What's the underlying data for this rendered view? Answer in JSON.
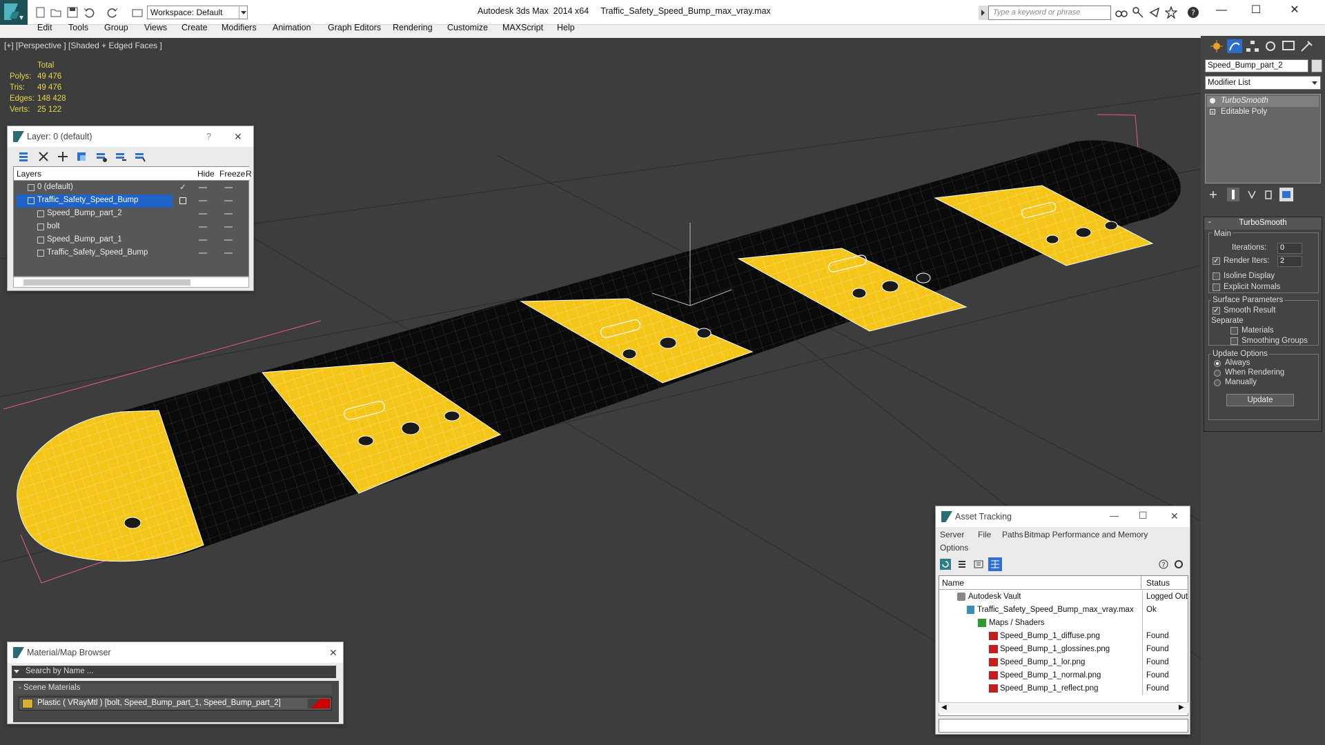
{
  "app": {
    "title": "Autodesk 3ds Max  2014 x64     Traffic_Safety_Speed_Bump_max_vray.max",
    "workspace": "Workspace: Default",
    "search_placeholder": "Type a keyword or phrase"
  },
  "menu": [
    "Edit",
    "Tools",
    "Group",
    "Views",
    "Create",
    "Modifiers",
    "Animation",
    "Graph Editors",
    "Rendering",
    "Customize",
    "MAXScript",
    "Help"
  ],
  "viewport": {
    "label": "[+] [Perspective ] [Shaded + Edged Faces ]",
    "stats": {
      "header": "Total",
      "rows": [
        {
          "k": "Polys:",
          "v": "49 476"
        },
        {
          "k": "Tris:",
          "v": "49 476"
        },
        {
          "k": "Edges:",
          "v": "148 428"
        },
        {
          "k": "Verts:",
          "v": "25 122"
        }
      ]
    },
    "colors": {
      "yellow": "#f5c518",
      "black": "#0a0a0a",
      "wire": "#ffffff",
      "bg": "#3d3d3d"
    }
  },
  "layer_panel": {
    "title": "Layer: 0 (default)",
    "help": "?",
    "close": "✕",
    "col_layers": "Layers",
    "col_hide": "Hide",
    "col_freeze": "Freeze",
    "col_r": "R",
    "rows": [
      {
        "name": "0 (default)"
      },
      {
        "name": "Traffic_Safety_Speed_Bump"
      },
      {
        "name": "Speed_Bump_part_2"
      },
      {
        "name": "bolt"
      },
      {
        "name": "Speed_Bump_part_1"
      },
      {
        "name": "Traffic_Safety_Speed_Bump"
      }
    ]
  },
  "material_browser": {
    "title": "Material/Map Browser",
    "close": "✕",
    "search_placeholder": "Search by Name ...",
    "section": "- Scene Materials",
    "item": "Plastic  ( VRayMtl )  [bolt, Speed_Bump_part_1, Speed_Bump_part_2]"
  },
  "asset_tracking": {
    "title": "Asset Tracking",
    "menu": [
      "Server",
      "File",
      "Paths",
      "Bitmap Performance and Memory"
    ],
    "menu2": "Options",
    "col_name": "Name",
    "col_status": "Status",
    "rows": [
      {
        "name": "Autodesk Vault",
        "status": "Logged Out"
      },
      {
        "name": "Traffic_Safety_Speed_Bump_max_vray.max",
        "status": "Ok"
      },
      {
        "name": "Maps / Shaders",
        "status": ""
      },
      {
        "name": "Speed_Bump_1_diffuse.png",
        "status": "Found"
      },
      {
        "name": "Speed_Bump_1_glossines.png",
        "status": "Found"
      },
      {
        "name": "Speed_Bump_1_lor.png",
        "status": "Found"
      },
      {
        "name": "Speed_Bump_1_normal.png",
        "status": "Found"
      },
      {
        "name": "Speed_Bump_1_reflect.png",
        "status": "Found"
      }
    ]
  },
  "command_panel": {
    "object_name": "Speed_Bump_part_2",
    "modifier_list": "Modifier List",
    "stack": [
      "TurboSmooth",
      "Editable Poly"
    ],
    "rollout_title": "TurboSmooth",
    "main": "Main",
    "iterations_label": "Iterations:",
    "iterations": "0",
    "render_iters_label": "Render Iters:",
    "render_iters": "2",
    "isoline": "Isoline Display",
    "explicit_normals": "Explicit Normals",
    "surface_params": "Surface Parameters",
    "smooth_result": "Smooth Result",
    "separate": "Separate",
    "materials": "Materials",
    "smoothing_groups": "Smoothing Groups",
    "update_options": "Update Options",
    "always": "Always",
    "when_rendering": "When Rendering",
    "manually": "Manually",
    "update_button": "Update"
  }
}
